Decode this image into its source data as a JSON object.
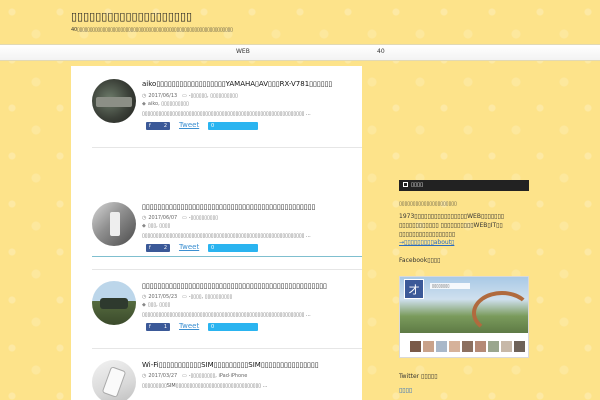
{
  "site": {
    "title": "▯▯▯▯▯▯▯▯▯▯▯▯▯▯▯▯▯▯▯▯",
    "description": "40▯▯▯▯▯▯▯▯▯▯▯▯▯▯▯▯▯▯▯▯▯▯▯▯▯▯▯▯▯▯▯▯▯▯▯▯▯▯▯▯▯▯▯▯▯▯▯▯▯▯▯▯▯▯▯▯▯▯▯▯▯"
  },
  "nav": {
    "items": [
      {
        "label": "WEB"
      },
      {
        "label": "40"
      }
    ]
  },
  "posts": [
    {
      "title": "aiko▯▯▯▯▯▯▯▯▯▯▯▯▯▯▯▯▯▯YAMAHA▯AV▯▯▯RX-V781▯▯▯▯▯▯",
      "date": "2017/06/13",
      "categories": "-▯▯▯▯▯▯, ▯▯▯▯▯▯▯▯▯▯",
      "tags": "aiko, ▯▯▯▯▯▯▯▯▯▯",
      "excerpt": "▯▯▯▯▯▯▯▯▯▯▯▯▯▯▯▯▯▯▯▯▯▯▯▯▯▯▯▯▯▯▯▯▯▯▯▯▯▯▯▯▯▯▯▯▯▯▯▯▯▯▯▯▯▯▯▯▯▯▯ ...",
      "fb_count": "2",
      "tweet_label": "Tweet",
      "pocket_count": "0"
    },
    {
      "title": "▯▯▯▯▯▯▯▯▯▯▯▯▯▯▯▯▯▯▯▯▯▯▯▯▯▯▯▯▯▯▯▯▯▯▯▯▯▯▯▯▯▯▯▯▯",
      "date": "2017/06/07",
      "categories": "-▯▯▯▯▯▯▯▯▯▯",
      "tags": "▯▯▯, ▯▯▯▯",
      "excerpt": "▯▯▯▯▯▯▯▯▯▯▯▯▯▯▯▯▯▯▯▯▯▯▯▯▯▯▯▯▯▯▯▯▯▯▯▯▯▯▯▯▯▯▯▯▯▯▯▯▯▯▯▯▯▯▯▯▯▯▯ ...",
      "fb_count": "2",
      "tweet_label": "Tweet",
      "pocket_count": "0"
    },
    {
      "title": "▯▯▯▯▯▯▯▯▯▯▯▯▯▯▯▯▯▯▯▯▯▯▯▯▯▯▯▯▯▯▯▯▯▯▯▯▯▯▯▯▯▯▯▯▯▯▯▯",
      "date": "2017/05/23",
      "categories": "-▯▯▯▯, ▯▯▯▯▯▯▯▯▯▯",
      "tags": "▯▯▯, ▯▯▯▯",
      "excerpt": "▯▯▯▯▯▯▯▯▯▯▯▯▯▯▯▯▯▯▯▯▯▯▯▯▯▯▯▯▯▯▯▯▯▯▯▯▯▯▯▯▯▯▯▯▯▯▯▯▯▯▯▯▯▯▯▯▯▯▯ ...",
      "fb_count": "1",
      "tweet_label": "Tweet",
      "pocket_count": "0"
    },
    {
      "title": "Wi-Fi▯▯▯▯▯▯▯▯▯▯▯SIM▯▯▯▯▯▯▯▯▯SIM▯▯▯▯▯▯▯▯▯▯▯▯▯▯▯",
      "date": "2017/03/27",
      "categories": "-▯▯▯▯▯▯▯▯▯, iPad·iPhone",
      "excerpt": "▯▯▯▯▯▯▯▯▯SIM▯▯▯▯▯▯▯▯▯▯▯▯▯▯▯▯▯▯▯▯▯▯▯▯▯▯▯▯▯▯▯ ..."
    }
  ],
  "sidebar": {
    "profile_head": "▯▯▯▯",
    "profile_name": "▯▯▯▯▯▯▯▯▯▯▯▯▯▯▯▯▯▯▯▯▯",
    "profile_line1": "1973▯▯▯▯▯▯▯▯▯▯▯▯▯▯▯▯WEB▯▯▯▯▯▯▯",
    "profile_line2": "▯▯▯▯▯▯▯▯▯▯▯▯ ▯▯▯▯▯▯▯▯▯▯WEB▯IT▯▯",
    "profile_line3": "▯▯▯▯▯▯▯▯▯▯▯▯▯▯▯▯▯",
    "profile_link": "→▯▯▯▯▯▯▯▯▯about▯",
    "facebook_head": "Facebook▯▯▯▯",
    "facebook_logo": "オ",
    "facebook_like": "▯▯▯▯▯▯▯▯",
    "twitter_head": "Twitter ▯▯▯▯▯",
    "next_head": "▯▯▯▯"
  },
  "colors": {
    "background": "#fde38a",
    "accent": "#7fbfcf",
    "facebook": "#3b5998",
    "pocket": "#2ab4f0",
    "link": "#2a6bbf"
  }
}
